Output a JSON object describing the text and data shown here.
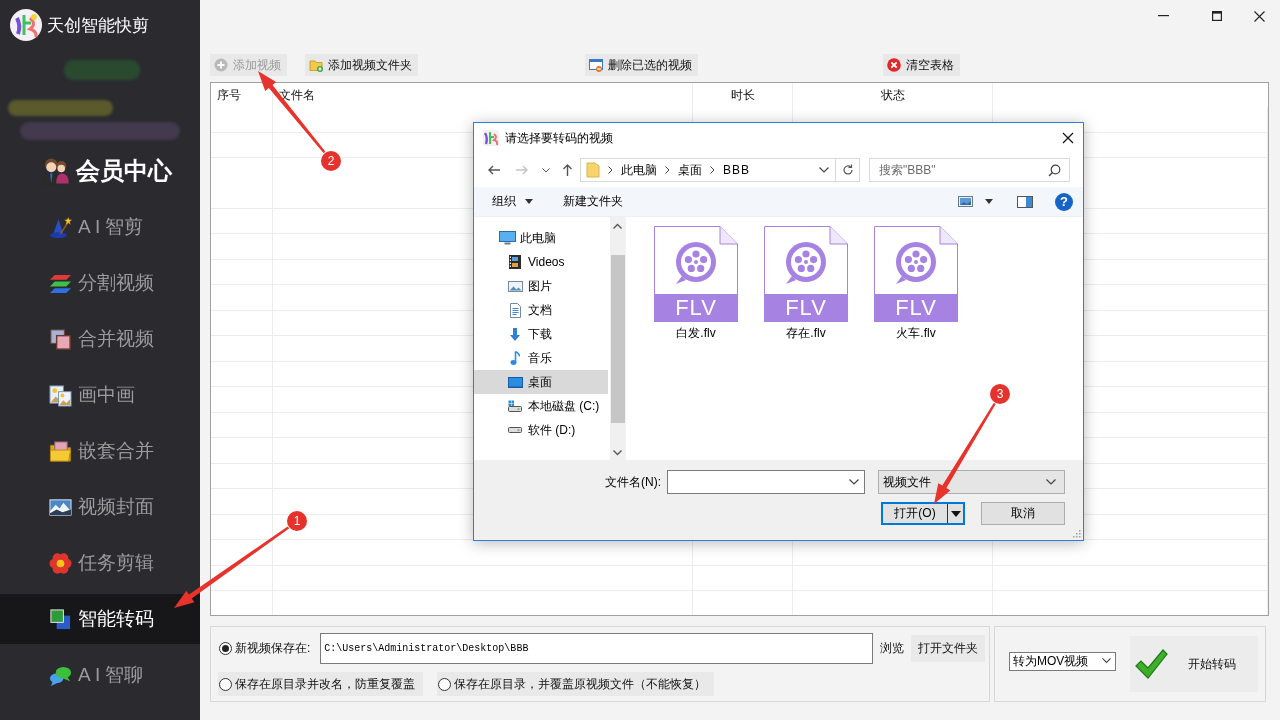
{
  "app": {
    "title": "天创智能快剪"
  },
  "sidebar": {
    "items": [
      {
        "label": "会员中心",
        "kind": "member",
        "selected": false
      },
      {
        "label": "A I 智剪",
        "kind": "tool",
        "selected": false
      },
      {
        "label": "分割视频",
        "kind": "tool",
        "selected": false
      },
      {
        "label": "合并视频",
        "kind": "tool",
        "selected": false
      },
      {
        "label": "画中画",
        "kind": "tool",
        "selected": false
      },
      {
        "label": "嵌套合并",
        "kind": "tool",
        "selected": false
      },
      {
        "label": "视频封面",
        "kind": "tool",
        "selected": false
      },
      {
        "label": "任务剪辑",
        "kind": "tool",
        "selected": false
      },
      {
        "label": "智能转码",
        "kind": "tool",
        "selected": true
      },
      {
        "label": "A I 智聊",
        "kind": "tool",
        "selected": false
      }
    ]
  },
  "toolbar": {
    "buttons": [
      {
        "label": "添加视频",
        "disabled": true
      },
      {
        "label": "添加视频文件夹",
        "disabled": false
      },
      {
        "label": "删除已选的视频",
        "disabled": false
      },
      {
        "label": "清空表格",
        "disabled": false
      }
    ]
  },
  "table": {
    "columns": [
      "序号",
      "文件名",
      "时长",
      "状态"
    ]
  },
  "save_options": [
    {
      "kind": "path",
      "label": "新视频保存在:",
      "selected": true
    },
    {
      "kind": "plain",
      "label": "保存在原目录并改名，防重复覆盖",
      "selected": false
    },
    {
      "kind": "plain",
      "label": "保存在原目录，并覆盖原视频文件（不能恢复）",
      "selected": false
    }
  ],
  "output_path": {
    "value": "C:\\Users\\Administrator\\Desktop\\BBB"
  },
  "path_buttons": [
    {
      "label": "浏览",
      "kind": "flat"
    },
    {
      "label": "打开文件夹",
      "kind": "raised"
    }
  ],
  "format_select": {
    "value": "转为MOV视频"
  },
  "start_button": {
    "label": "开始转码"
  },
  "dialog": {
    "title": "请选择要转码的视频",
    "nav_buttons": [
      {
        "kind": "back",
        "disabled": false
      },
      {
        "kind": "forward",
        "disabled": true
      },
      {
        "kind": "recent",
        "disabled": false
      },
      {
        "kind": "up",
        "disabled": false
      }
    ],
    "breadcrumb": [
      "此电脑",
      "桌面",
      "BBB"
    ],
    "search": {
      "placeholder": "搜索\"BBB\""
    },
    "commands": [
      {
        "label": "组织",
        "kind": "menu"
      },
      {
        "label": "新建文件夹",
        "kind": "button"
      }
    ],
    "help": "?",
    "nav_tree": [
      {
        "label": "此电脑",
        "selected": false,
        "children": [
          {
            "label": "Videos",
            "selected": false
          },
          {
            "label": "图片",
            "selected": false
          },
          {
            "label": "文档",
            "selected": false
          },
          {
            "label": "下载",
            "selected": false
          },
          {
            "label": "音乐",
            "selected": false
          },
          {
            "label": "桌面",
            "selected": true
          },
          {
            "label": "本地磁盘 (C:)",
            "selected": false
          },
          {
            "label": "软件 (D:)",
            "selected": false
          }
        ]
      }
    ],
    "files": [
      {
        "name": "白发.flv",
        "type": "FLV"
      },
      {
        "name": "存在.flv",
        "type": "FLV"
      },
      {
        "name": "火车.flv",
        "type": "FLV"
      }
    ],
    "filename": {
      "label": "文件名(N):"
    },
    "filter": {
      "value": "视频文件"
    },
    "buttons": [
      {
        "label": "打开(O)",
        "kind": "split",
        "default": true
      },
      {
        "label": "取消",
        "kind": "plain",
        "default": false
      }
    ]
  },
  "annotations": [
    {
      "number": "1"
    },
    {
      "number": "2"
    },
    {
      "number": "3"
    }
  ]
}
